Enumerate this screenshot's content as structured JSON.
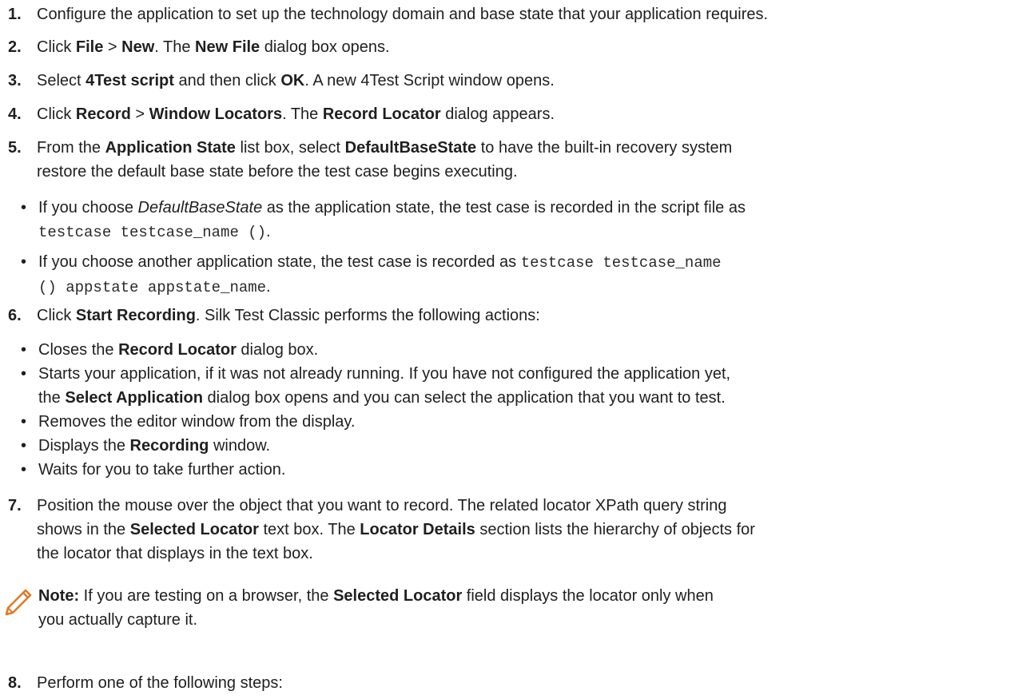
{
  "steps": [
    {
      "num": "1.",
      "text": "Configure the application to set up the technology domain and base state that your application requires."
    },
    {
      "num": "2.",
      "a": "Click ",
      "b1": "File",
      "c": " > ",
      "b2": "New",
      "d": ". The ",
      "b3": "New File",
      "e": " dialog box opens."
    },
    {
      "num": "3.",
      "a": "Select ",
      "b1": "4Test script",
      "c": " and then click ",
      "b2": "OK",
      "d": ". A new 4Test Script window opens."
    },
    {
      "num": "4.",
      "a": "Click ",
      "b1": "Record",
      "c": " > ",
      "b2": "Window Locators",
      "d": ". The ",
      "b3": "Record Locator",
      "e": " dialog appears."
    },
    {
      "num": "5.",
      "a": "From the ",
      "b1": "Application State",
      "c": " list box, select ",
      "b2": "DefaultBaseState",
      "d": " to have the built-in recovery system",
      "line2": "restore the default base state before the test case begins executing."
    },
    {
      "num": "6.",
      "a": "Click ",
      "b1": "Start Recording",
      "c": ". Silk Test Classic performs the following actions:"
    },
    {
      "num": "7.",
      "line1": "Position the mouse over the object that you want to record. The related locator XPath query string",
      "l2a": "shows in the ",
      "l2b1": "Selected Locator",
      "l2c": " text box. The ",
      "l2b2": "Locator Details",
      "l2d": " section lists the hierarchy of objects for",
      "line3": "the locator that displays in the text box."
    },
    {
      "num": "8.",
      "text": "Perform one of the following steps:"
    }
  ],
  "step5_bullets": [
    {
      "a": "If you choose ",
      "i": "DefaultBaseState",
      "b": " as the application state, the test case is recorded in the script file as",
      "code": "testcase testcase_name ()",
      "end": "."
    },
    {
      "a": "If you choose another application state, the test case is recorded as ",
      "code1": "testcase testcase_name",
      "code2": "() appstate appstate_name",
      "end": "."
    }
  ],
  "step6_bullets": [
    {
      "a": "Closes the ",
      "b": "Record Locator",
      "c": " dialog box."
    },
    {
      "line1": "Starts your application, if it was not already running. If you have not configured the application yet,",
      "l2a": "the ",
      "l2b": "Select Application",
      "l2c": " dialog box opens and you can select the application that you want to test."
    },
    {
      "text": "Removes the editor window from the display."
    },
    {
      "a": "Displays the ",
      "b": "Recording",
      "c": " window."
    },
    {
      "text": "Waits for you to take further action."
    }
  ],
  "note": {
    "icon": "pencil-icon",
    "label": "Note:",
    "a": " If you are testing on a browser, the ",
    "b": "Selected Locator",
    "c": " field displays the locator only when",
    "line2": "you actually capture it."
  },
  "bullet_char": "•",
  "colors": {
    "text": "#1f1f1f",
    "pencil": "#e07b2a"
  }
}
